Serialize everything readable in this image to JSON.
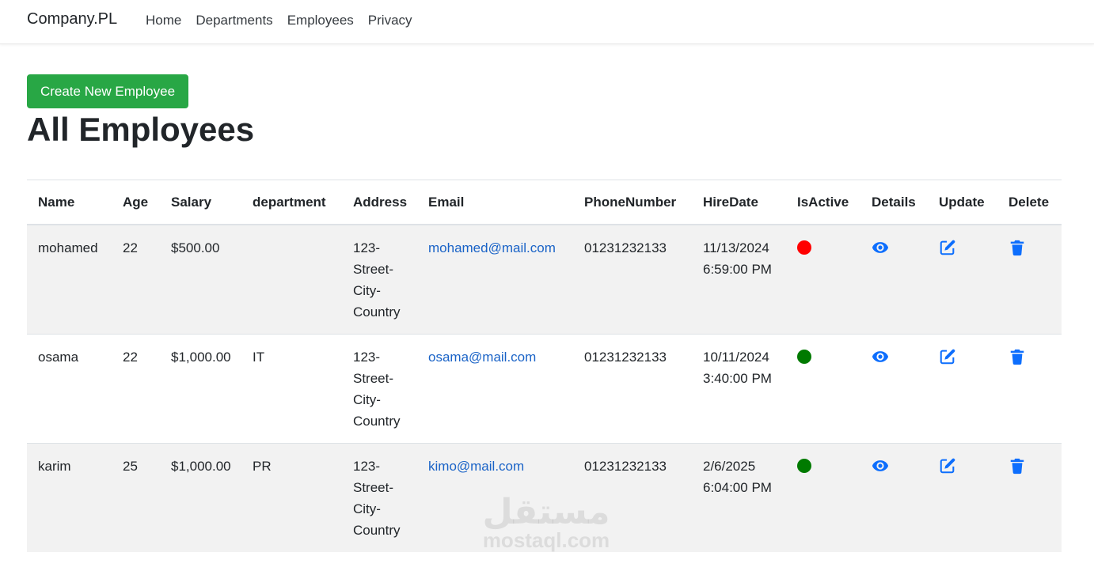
{
  "navbar": {
    "brand": "Company.PL",
    "links": [
      "Home",
      "Departments",
      "Employees",
      "Privacy"
    ]
  },
  "actions": {
    "create_label": "Create New Employee"
  },
  "page": {
    "title": "All Employees"
  },
  "table": {
    "headers": [
      "Name",
      "Age",
      "Salary",
      "department",
      "Address",
      "Email",
      "PhoneNumber",
      "HireDate",
      "IsActive",
      "Details",
      "Update",
      "Delete"
    ],
    "rows": [
      {
        "name": "mohamed",
        "age": "22",
        "salary": "$500.00",
        "department": "",
        "address": "123-Street-City-Country",
        "email": "mohamed@mail.com",
        "phone": "01231232133",
        "hire_date": "11/13/2024",
        "hire_time": "6:59:00 PM",
        "is_active": false,
        "status_color": "#ff0000"
      },
      {
        "name": "osama",
        "age": "22",
        "salary": "$1,000.00",
        "department": "IT",
        "address": "123-Street-City-Country",
        "email": "osama@mail.com",
        "phone": "01231232133",
        "hire_date": "10/11/2024",
        "hire_time": "3:40:00 PM",
        "is_active": true,
        "status_color": "#007a00"
      },
      {
        "name": "karim",
        "age": "25",
        "salary": "$1,000.00",
        "department": "PR",
        "address": "123-Street-City-Country",
        "email": "kimo@mail.com",
        "phone": "01231232133",
        "hire_date": "2/6/2025",
        "hire_time": "6:04:00 PM",
        "is_active": true,
        "status_color": "#007a00"
      }
    ]
  },
  "icons": {
    "details": "eye-icon",
    "update": "edit-icon",
    "delete": "trash-icon",
    "color": "#0d6efd"
  },
  "watermark": {
    "arabic": "مستقل",
    "latin": "mostaql.com"
  }
}
